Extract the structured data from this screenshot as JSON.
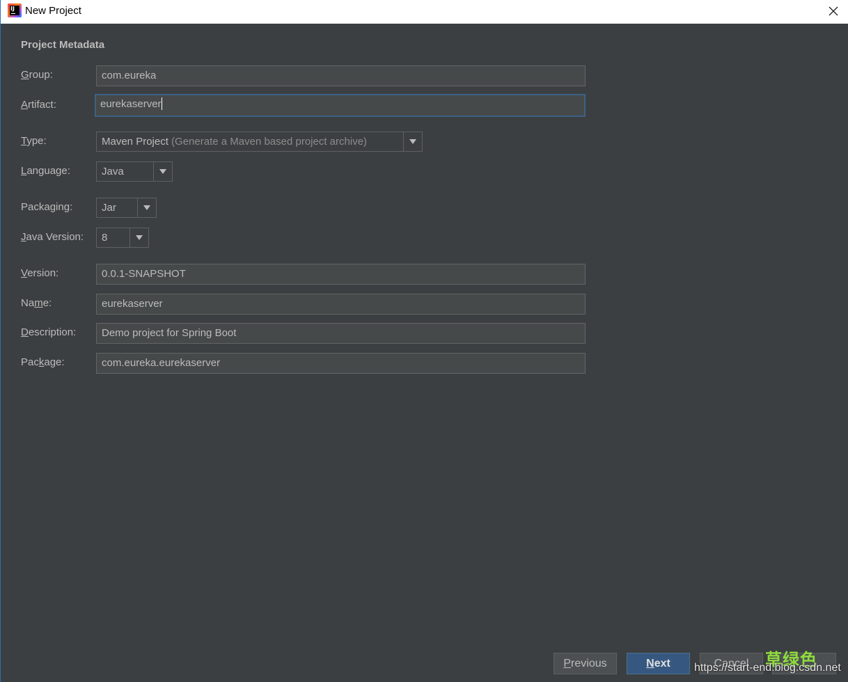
{
  "window": {
    "title": "New Project",
    "app_icon_text": "IJ"
  },
  "section": {
    "title": "Project Metadata"
  },
  "fields": {
    "group": {
      "label_mnemonic": "G",
      "label_rest": "roup:",
      "value": "com.eureka"
    },
    "artifact": {
      "label_mnemonic": "A",
      "label_rest": "rtifact:",
      "value": "eurekaserver"
    },
    "type": {
      "label_mnemonic": "T",
      "label_rest": "ype:",
      "value": "Maven Project",
      "hint": "(Generate a Maven based project archive)"
    },
    "language": {
      "label_mnemonic": "L",
      "label_rest": "anguage:",
      "value": "Java"
    },
    "packaging": {
      "label_pre": "Packa",
      "label_mnemonic": "g",
      "label_rest": "ing:",
      "value": "Jar"
    },
    "java_version": {
      "label_mnemonic": "J",
      "label_rest": "ava Version:",
      "value": "8"
    },
    "version": {
      "label_mnemonic": "V",
      "label_rest": "ersion:",
      "value": "0.0.1-SNAPSHOT"
    },
    "name": {
      "label_pre": "Na",
      "label_mnemonic": "m",
      "label_rest": "e:",
      "value": "eurekaserver"
    },
    "description": {
      "label_mnemonic": "D",
      "label_rest": "escription:",
      "value": "Demo project for Spring Boot"
    },
    "package": {
      "label_pre": "Pac",
      "label_mnemonic": "k",
      "label_rest": "age:",
      "value": "com.eureka.eurekaserver"
    }
  },
  "buttons": {
    "previous": {
      "mnemonic": "P",
      "rest": "revious"
    },
    "next": {
      "mnemonic": "N",
      "rest": "ext"
    },
    "cancel": {
      "label": "Cancel"
    }
  },
  "watermark": {
    "cn_text": "草绿色",
    "url": "https://start-end.blog.csdn.net"
  },
  "colors": {
    "background": "#3c3f41",
    "field_bg": "#45494a",
    "focus_border": "#3d6185",
    "primary_button": "#365880",
    "text": "#bbbbbb"
  }
}
